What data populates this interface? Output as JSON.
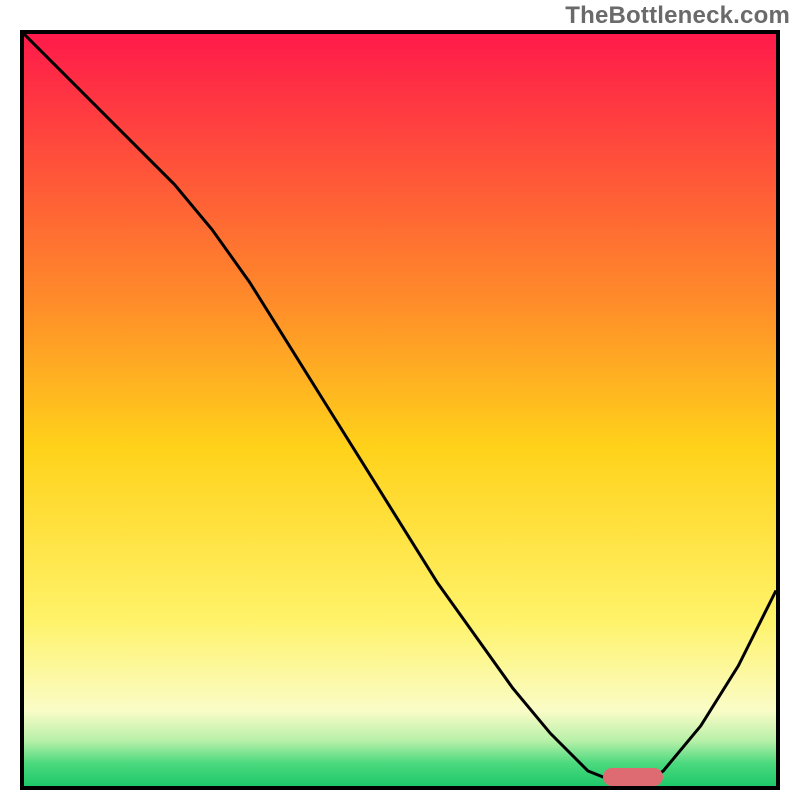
{
  "watermark": "TheBottleneck.com",
  "colors": {
    "top": "#ff1a4a",
    "mid1": "#ff8a2a",
    "mid2": "#ffd21a",
    "mid3": "#fff36a",
    "mid4": "#fafcc7",
    "green1": "#b7f0a8",
    "green2": "#4bd97e",
    "green3": "#1ec96a",
    "border": "#000000",
    "curve": "#000000",
    "marker": "#df6b72"
  },
  "chart_data": {
    "type": "line",
    "title": "",
    "xlabel": "",
    "ylabel": "",
    "xlim": [
      0,
      100
    ],
    "ylim": [
      0,
      100
    ],
    "x": [
      0,
      5,
      10,
      15,
      20,
      25,
      30,
      35,
      40,
      45,
      50,
      55,
      60,
      65,
      70,
      75,
      80,
      82,
      85,
      90,
      95,
      100
    ],
    "values": [
      100,
      95,
      90,
      85,
      80,
      74,
      67,
      59,
      51,
      43,
      35,
      27,
      20,
      13,
      7,
      2,
      0,
      0,
      2,
      8,
      16,
      26
    ],
    "marker": {
      "x_start": 77,
      "x_end": 85,
      "y": 0
    },
    "gradient_stops": [
      {
        "pos": 0.0,
        "key": "top"
      },
      {
        "pos": 0.35,
        "key": "mid1"
      },
      {
        "pos": 0.55,
        "key": "mid2"
      },
      {
        "pos": 0.78,
        "key": "mid3"
      },
      {
        "pos": 0.9,
        "key": "mid4"
      },
      {
        "pos": 0.94,
        "key": "green1"
      },
      {
        "pos": 0.97,
        "key": "green2"
      },
      {
        "pos": 1.0,
        "key": "green3"
      }
    ]
  }
}
